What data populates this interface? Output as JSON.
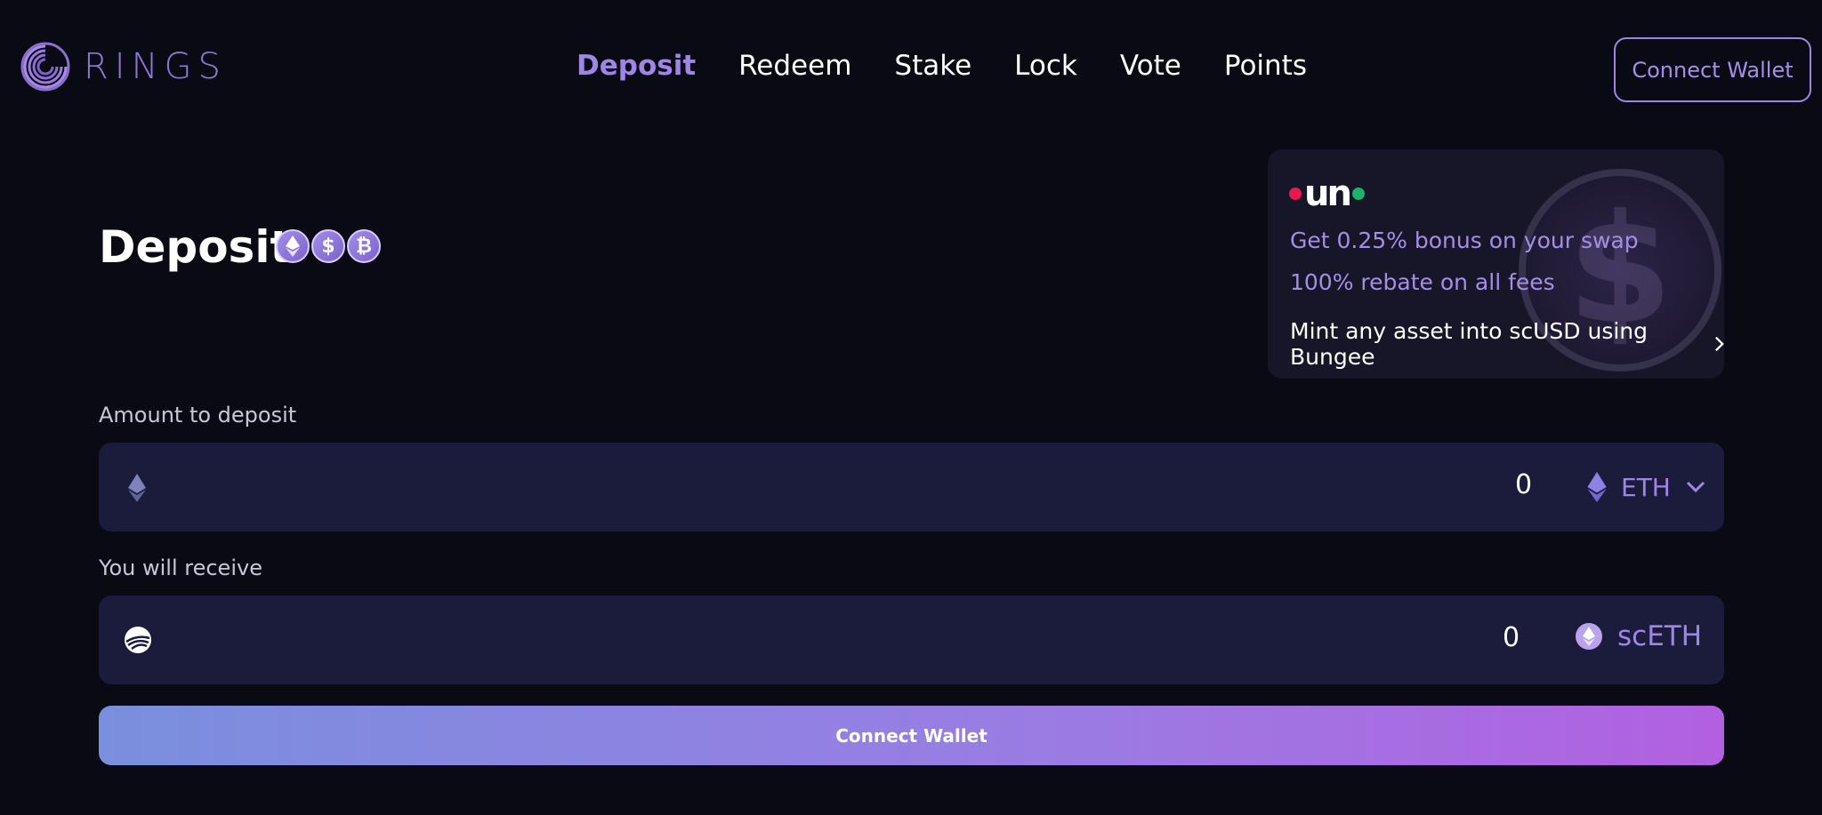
{
  "brand": {
    "name": "RINGS"
  },
  "nav": {
    "items": [
      {
        "label": "Deposit",
        "active": true
      },
      {
        "label": "Redeem",
        "active": false
      },
      {
        "label": "Stake",
        "active": false
      },
      {
        "label": "Lock",
        "active": false
      },
      {
        "label": "Vote",
        "active": false
      },
      {
        "label": "Points",
        "active": false
      }
    ]
  },
  "header": {
    "connect_label": "Connect Wallet"
  },
  "page": {
    "title": "Deposit",
    "coins": [
      "ethereum-icon",
      "dollar-icon",
      "bitcoin-icon"
    ]
  },
  "promo": {
    "brand": "un",
    "line1": "Get 0.25% bonus on your swap",
    "line2": "100% rebate on all fees",
    "link": "Mint any asset into scUSD using Bungee"
  },
  "deposit": {
    "label": "Amount to deposit",
    "value": "0",
    "token": "ETH",
    "icon": "ethereum-icon"
  },
  "receive": {
    "label": "You will receive",
    "value": "0",
    "token": "scETH",
    "icon": "sonic-icon"
  },
  "cta": {
    "label": "Connect Wallet"
  },
  "colors": {
    "background": "#0a0a14",
    "accent": "#9f86e6",
    "field": "#1b1c3b",
    "uno_red": "#e8194f",
    "uno_green": "#19b36b"
  }
}
